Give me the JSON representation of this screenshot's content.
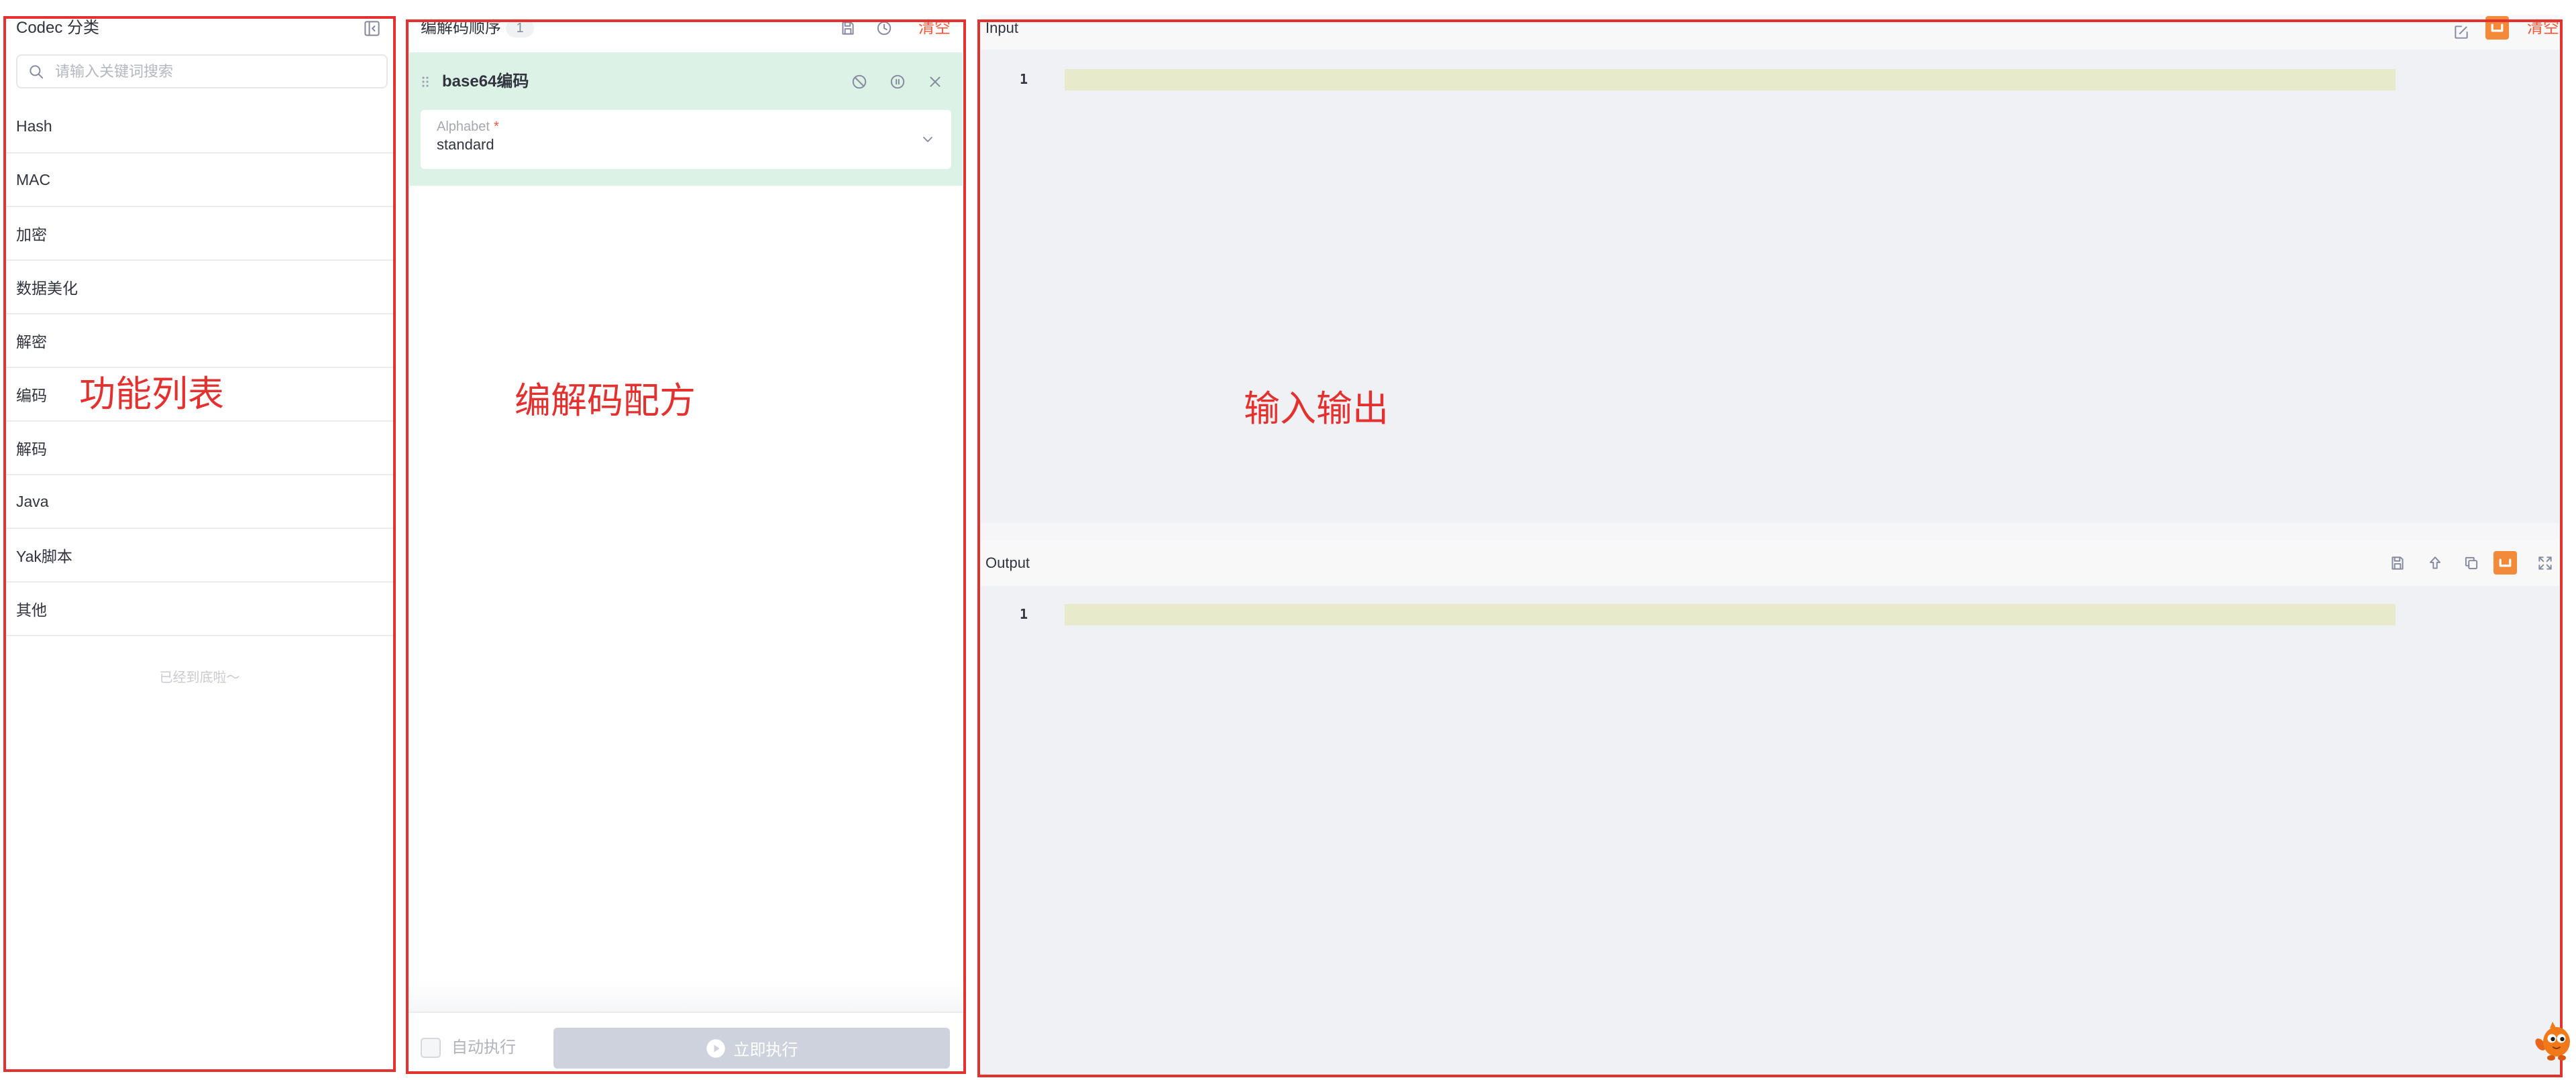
{
  "left_panel": {
    "title": "Codec 分类",
    "search_placeholder": "请输入关键词搜索",
    "categories": [
      "Hash",
      "MAC",
      "加密",
      "数据美化",
      "解密",
      "编码",
      "解码",
      "Java",
      "Yak脚本",
      "其他"
    ],
    "end_text": "已经到底啦～"
  },
  "recipe_panel": {
    "title": "编解码顺序",
    "count": "1",
    "clear_label": "清空",
    "steps": [
      {
        "name": "base64编码",
        "field_label": "Alphabet",
        "required_mark": "*",
        "field_value": "standard"
      }
    ],
    "auto_run_label": "自动执行",
    "auto_run_checked": false,
    "run_label": "立即执行",
    "run_enabled": false
  },
  "io_panel": {
    "input": {
      "title": "Input",
      "clear_label": "清空",
      "line_numbers": [
        "1"
      ]
    },
    "output": {
      "title": "Output",
      "line_numbers": [
        "1"
      ]
    }
  },
  "annotations": {
    "function_list": "功能列表",
    "recipe": "编解码配方",
    "input_output": "输入输出"
  },
  "colors": {
    "annotation_red": "#e2312f",
    "clear_red": "#f4563a",
    "accent_orange": "#f28a3a",
    "card_green": "#dcf2e6",
    "line_highlight": "#e7ebcc",
    "editor_bg": "#f0f1f5"
  },
  "icons": {
    "left_panel": [
      "collapse-icon",
      "search-icon"
    ],
    "recipe_header": [
      "save-icon",
      "history-icon"
    ],
    "recipe_step": [
      "drag-handle-icon",
      "ban-icon",
      "pause-icon",
      "close-icon",
      "chevron-down-icon"
    ],
    "run_button": "play-icon",
    "input_header": [
      "edit-icon",
      "wrap-toggle-icon"
    ],
    "output_header": [
      "save-icon",
      "upload-icon",
      "copy-icon",
      "wrap-toggle-icon",
      "expand-icon"
    ],
    "assistant": "mascot-icon"
  }
}
